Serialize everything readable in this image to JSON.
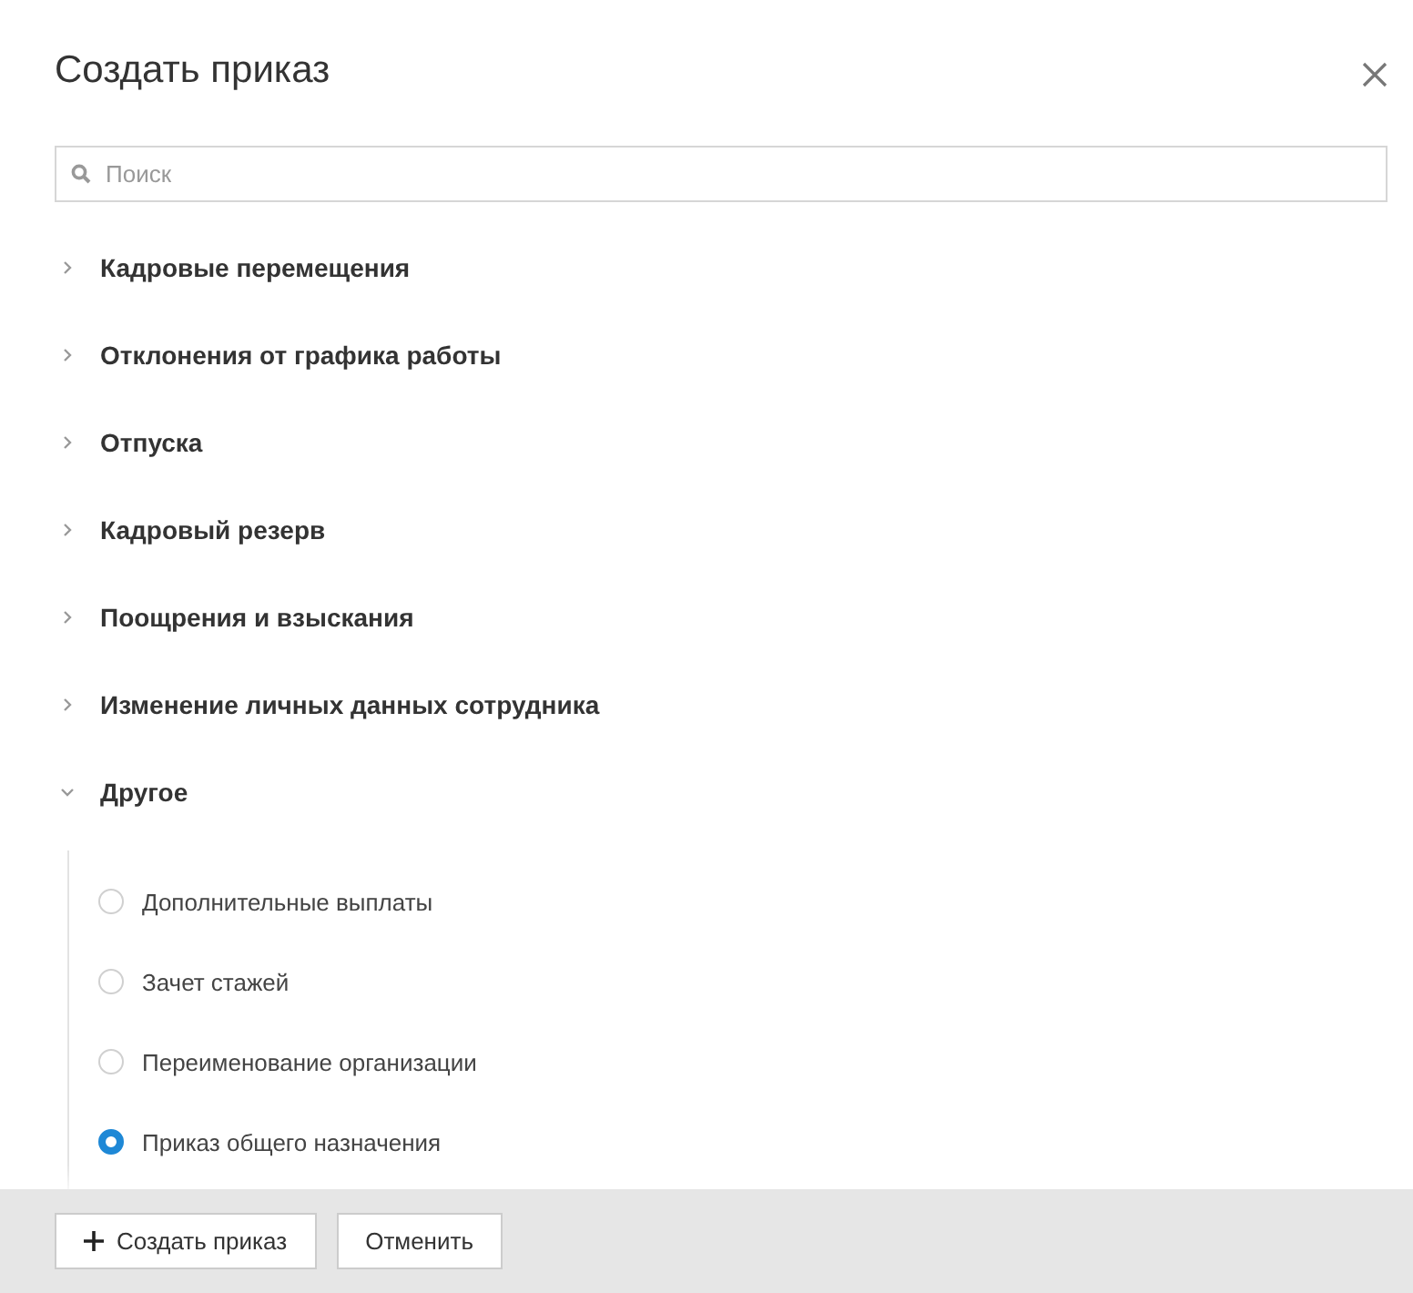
{
  "dialog": {
    "title": "Создать приказ"
  },
  "search": {
    "placeholder": "Поиск"
  },
  "groups": [
    {
      "label": "Кадровые перемещения",
      "expanded": false
    },
    {
      "label": "Отклонения от графика работы",
      "expanded": false
    },
    {
      "label": "Отпуска",
      "expanded": false
    },
    {
      "label": "Кадровый резерв",
      "expanded": false
    },
    {
      "label": "Поощрения и взыскания",
      "expanded": false
    },
    {
      "label": "Изменение личных данных сотрудника",
      "expanded": false
    },
    {
      "label": "Другое",
      "expanded": true,
      "children": [
        {
          "label": "Дополнительные выплаты",
          "selected": false
        },
        {
          "label": "Зачет стажей",
          "selected": false
        },
        {
          "label": "Переименование организации",
          "selected": false
        },
        {
          "label": "Приказ общего назначения",
          "selected": true
        }
      ]
    }
  ],
  "buttons": [
    {
      "label": "Создать приказ",
      "kind": "primary"
    },
    {
      "label": "Отменить",
      "kind": "plain"
    }
  ]
}
